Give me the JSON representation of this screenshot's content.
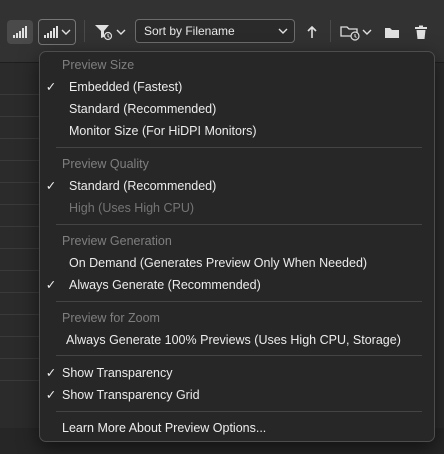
{
  "toolbar": {
    "sort_label": "Sort by Filename",
    "icons": [
      "thumbnail-size-icon",
      "thumbnail-quality-icon",
      "filter-icon",
      "sort-direction-icon",
      "recent-folder-icon",
      "new-folder-icon",
      "trash-icon"
    ]
  },
  "menu": {
    "sections": [
      {
        "header": "Preview Size",
        "items": [
          {
            "label": "Embedded (Fastest)",
            "checked": true,
            "enabled": true
          },
          {
            "label": "Standard (Recommended)",
            "checked": false,
            "enabled": true
          },
          {
            "label": "Monitor Size (For HiDPI Monitors)",
            "checked": false,
            "enabled": true
          }
        ]
      },
      {
        "header": "Preview Quality",
        "items": [
          {
            "label": "Standard (Recommended)",
            "checked": true,
            "enabled": true
          },
          {
            "label": "High (Uses High CPU)",
            "checked": false,
            "enabled": false
          }
        ]
      },
      {
        "header": "Preview Generation",
        "items": [
          {
            "label": "On Demand (Generates Preview Only When Needed)",
            "checked": false,
            "enabled": true
          },
          {
            "label": "Always Generate (Recommended)",
            "checked": true,
            "enabled": true
          }
        ]
      },
      {
        "header": "Preview for Zoom",
        "items": [
          {
            "label": "Always Generate 100% Previews (Uses High CPU, Storage)",
            "checked": false,
            "enabled": true
          }
        ]
      }
    ],
    "toggles": [
      {
        "label": "Show Transparency",
        "checked": true
      },
      {
        "label": "Show Transparency Grid",
        "checked": true
      }
    ],
    "learn_more": "Learn More About Preview Options...",
    "check_glyph": "✓"
  }
}
